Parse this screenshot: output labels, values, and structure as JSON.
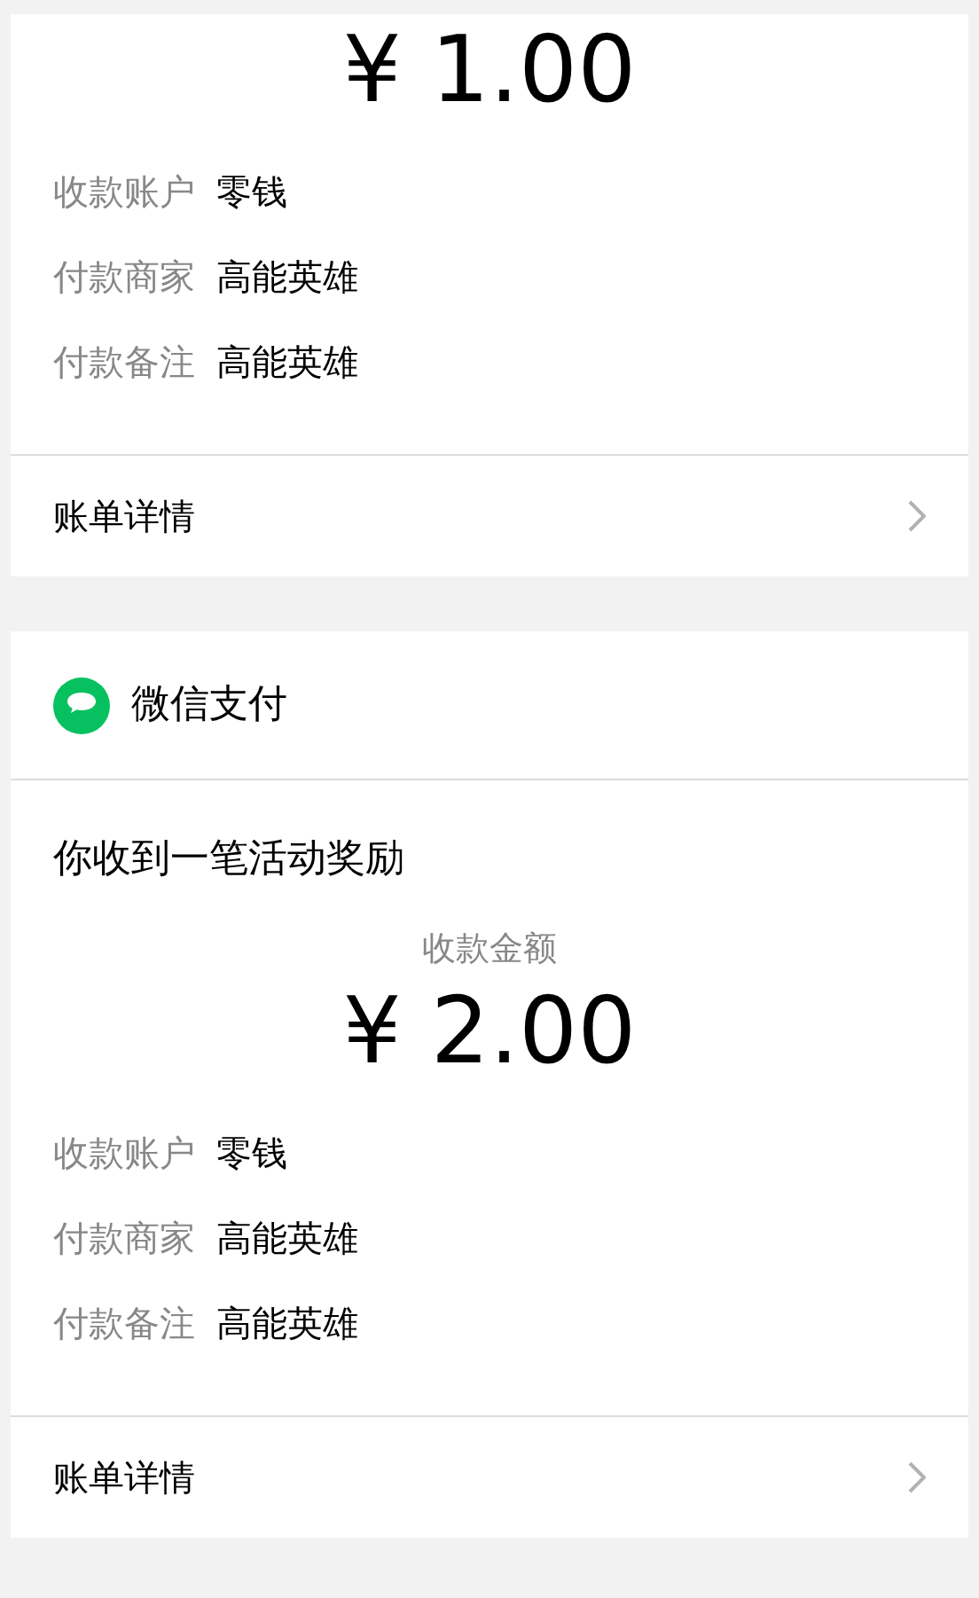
{
  "cards": [
    {
      "amount": "¥ 1.00",
      "rows": [
        {
          "label": "收款账户",
          "value": "零钱"
        },
        {
          "label": "付款商家",
          "value": "高能英雄"
        },
        {
          "label": "付款备注",
          "value": "高能英雄"
        }
      ],
      "details": "账单详情"
    },
    {
      "header": "微信支付",
      "title": "你收到一笔活动奖励",
      "amount_label": "收款金额",
      "amount": "¥ 2.00",
      "rows": [
        {
          "label": "收款账户",
          "value": "零钱"
        },
        {
          "label": "付款商家",
          "value": "高能英雄"
        },
        {
          "label": "付款备注",
          "value": "高能英雄"
        }
      ],
      "details": "账单详情"
    }
  ]
}
